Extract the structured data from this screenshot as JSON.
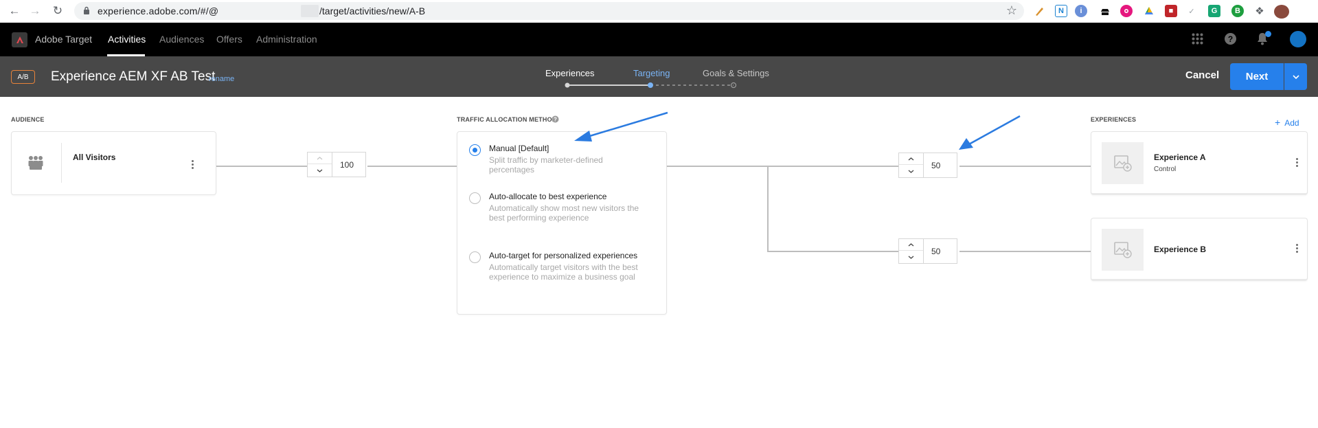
{
  "browser": {
    "url_prefix": "experience.adobe.com/#/@",
    "url_suffix": "/target/activities/new/A-B"
  },
  "nav": {
    "app_name": "Adobe Target",
    "items": [
      "Activities",
      "Audiences",
      "Offers",
      "Administration"
    ]
  },
  "activity": {
    "badge": "A/B",
    "title": "Experience AEM XF AB Test",
    "rename": "rename",
    "steps": [
      "Experiences",
      "Targeting",
      "Goals & Settings"
    ],
    "cancel": "Cancel",
    "next": "Next"
  },
  "audience": {
    "section_label": "AUDIENCE",
    "name": "All Visitors",
    "traffic": "100"
  },
  "traffic": {
    "section_label": "TRAFFIC ALLOCATION METHOD",
    "options": [
      {
        "title": "Manual [Default]",
        "desc": "Split traffic by marketer-defined percentages",
        "selected": true
      },
      {
        "title": "Auto-allocate to best experience",
        "desc": "Automatically show most new visitors the best performing experience",
        "selected": false
      },
      {
        "title": "Auto-target for personalized experiences",
        "desc": "Automatically target visitors with the best experience to maximize a business goal",
        "selected": false
      }
    ]
  },
  "experiences": {
    "section_label": "EXPERIENCES",
    "add": "Add",
    "items": [
      {
        "name": "Experience A",
        "sub": "Control",
        "split": "50"
      },
      {
        "name": "Experience B",
        "sub": "",
        "split": "50"
      }
    ]
  },
  "colors": {
    "accent": "#2680eb",
    "annotation_arrow": "#2b7be0",
    "badge_border": "#e8833a"
  }
}
